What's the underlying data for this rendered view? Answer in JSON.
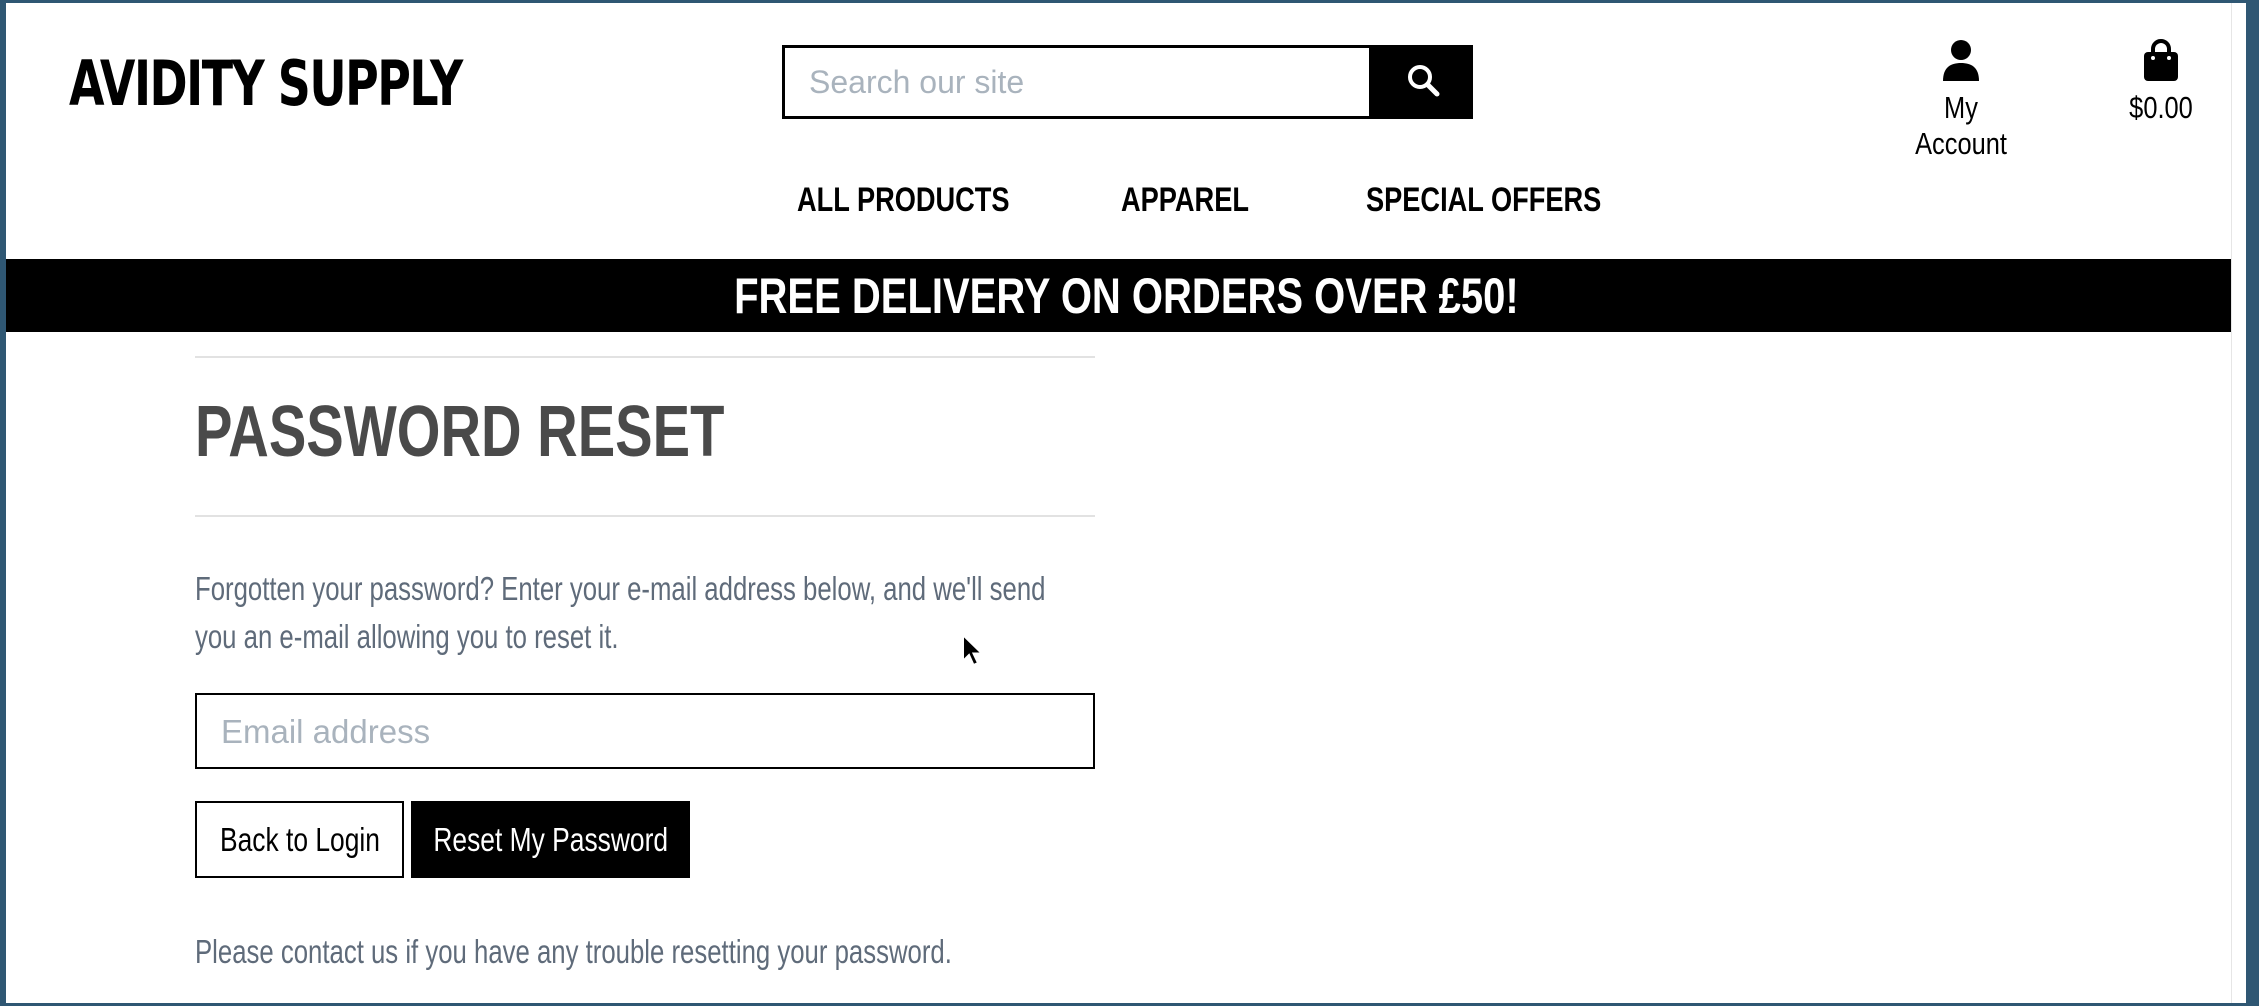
{
  "header": {
    "logo": "AVIDITY SUPPLY",
    "search": {
      "placeholder": "Search our site",
      "button_icon": "search-icon"
    },
    "account": {
      "label": "My Account",
      "icon": "user-icon"
    },
    "cart": {
      "label": "$0.00",
      "icon": "shopping-bag-icon"
    }
  },
  "nav": {
    "items": [
      {
        "label": "ALL PRODUCTS"
      },
      {
        "label": "APPAREL"
      },
      {
        "label": "SPECIAL OFFERS"
      }
    ]
  },
  "banner": {
    "text": "FREE DELIVERY ON ORDERS OVER £50!"
  },
  "main": {
    "title": "PASSWORD RESET",
    "intro": "Forgotten your password? Enter your e-mail address below, and we'll send you an e-mail allowing you to reset it.",
    "email": {
      "placeholder": "Email address",
      "value": ""
    },
    "back_button": "Back to Login",
    "reset_button": "Reset My Password",
    "contact_note": "Please contact us if you have any trouble resetting your password."
  },
  "colors": {
    "brand": "#000000",
    "heading": "#4a4a4a",
    "body_text": "#5f6b7a",
    "placeholder": "#a9b3bd",
    "divider": "#e2e2e2"
  }
}
